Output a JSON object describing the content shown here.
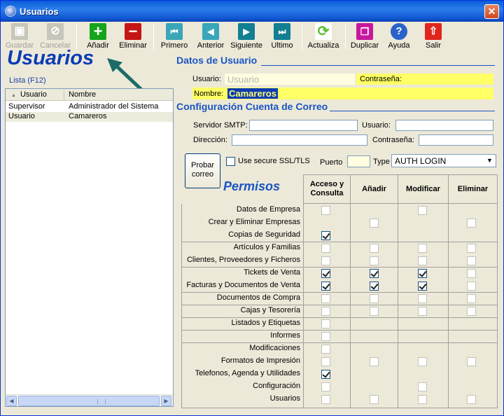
{
  "window": {
    "title": "Usuarios",
    "close": "✕"
  },
  "toolbar": {
    "guardar": "Guardar",
    "cancelar": "Cancelar",
    "anadir": "Añadir",
    "eliminar": "Eliminar",
    "primero": "Primero",
    "anterior": "Anterior",
    "siguiente": "Siguiente",
    "ultimo": "Ultimo",
    "actualiza": "Actualiza",
    "duplicar": "Duplicar",
    "ayuda": "Ayuda",
    "salir": "Salir"
  },
  "header": {
    "title": "Usuarios"
  },
  "list": {
    "label": "Lista (F12)",
    "col_usuario": "Usuario",
    "col_nombre": "Nombre",
    "rows": [
      {
        "usuario": "Supervisor",
        "nombre": "Administrador del Sistema"
      },
      {
        "usuario": "Usuario",
        "nombre": "Camareros"
      }
    ]
  },
  "datos": {
    "title": "Datos de Usuario",
    "usuario_label": "Usuario:",
    "usuario_value": "Usuario",
    "contrasena_label": "Contraseña:",
    "nombre_label": "Nombre:",
    "nombre_value": "Camareros"
  },
  "correo": {
    "title": "Configuración Cuenta de Correo",
    "smtp_label": "Servidor SMTP:",
    "usuario_label": "Usuario:",
    "direccion_label": "Dirección:",
    "contrasena_label": "Contraseña:",
    "probar_line1": "Probar",
    "probar_line2": "correo",
    "ssl_label": "Use secure SSL/TLS",
    "puerto_label": "Puerto",
    "type_label": "Type",
    "type_value": "AUTH LOGIN"
  },
  "permisos": {
    "title": "Permisos",
    "headers": {
      "acceso_line1": "Acceso y",
      "acceso_line2": "Consulta",
      "anadir": "Añadir",
      "modificar": "Modificar",
      "eliminar": "Eliminar"
    },
    "rows": [
      {
        "label": "Datos de Empresa",
        "acceso": false,
        "anadir": null,
        "modificar": false,
        "eliminar": null
      },
      {
        "label": "Crear y Eliminar Empresas",
        "acceso": null,
        "anadir": false,
        "modificar": null,
        "eliminar": false
      },
      {
        "label": "Copias de Seguridad",
        "acceso": true,
        "anadir": null,
        "modificar": null,
        "eliminar": null
      },
      {
        "label": "Artículos y Familias",
        "acceso": false,
        "anadir": false,
        "modificar": false,
        "eliminar": false
      },
      {
        "label": "Clientes, Proveedores y Ficheros",
        "acceso": false,
        "anadir": false,
        "modificar": false,
        "eliminar": false
      },
      {
        "label": "Tickets de Venta",
        "acceso": true,
        "anadir": true,
        "modificar": true,
        "eliminar": false
      },
      {
        "label": "Facturas y Documentos de Venta",
        "acceso": true,
        "anadir": true,
        "modificar": true,
        "eliminar": false
      },
      {
        "label": "Documentos de Compra",
        "acceso": false,
        "anadir": false,
        "modificar": false,
        "eliminar": false
      },
      {
        "label": "Cajas y Tesorería",
        "acceso": false,
        "anadir": false,
        "modificar": false,
        "eliminar": false
      },
      {
        "label": "Listados y Etiquetas",
        "acceso": false,
        "anadir": null,
        "modificar": null,
        "eliminar": null
      },
      {
        "label": "Informes",
        "acceso": false,
        "anadir": null,
        "modificar": null,
        "eliminar": null
      },
      {
        "label": "Modificaciones",
        "acceso": false,
        "anadir": null,
        "modificar": null,
        "eliminar": null
      },
      {
        "label": "Formatos de Impresión",
        "acceso": false,
        "anadir": false,
        "modificar": false,
        "eliminar": false
      },
      {
        "label": "Telefonos, Agenda y Utilidades",
        "acceso": true,
        "anadir": null,
        "modificar": null,
        "eliminar": null
      },
      {
        "label": "Configuración",
        "acceso": false,
        "anadir": null,
        "modificar": false,
        "eliminar": null
      },
      {
        "label": "Usuarios",
        "acceso": false,
        "anadir": false,
        "modificar": false,
        "eliminar": false
      }
    ]
  }
}
